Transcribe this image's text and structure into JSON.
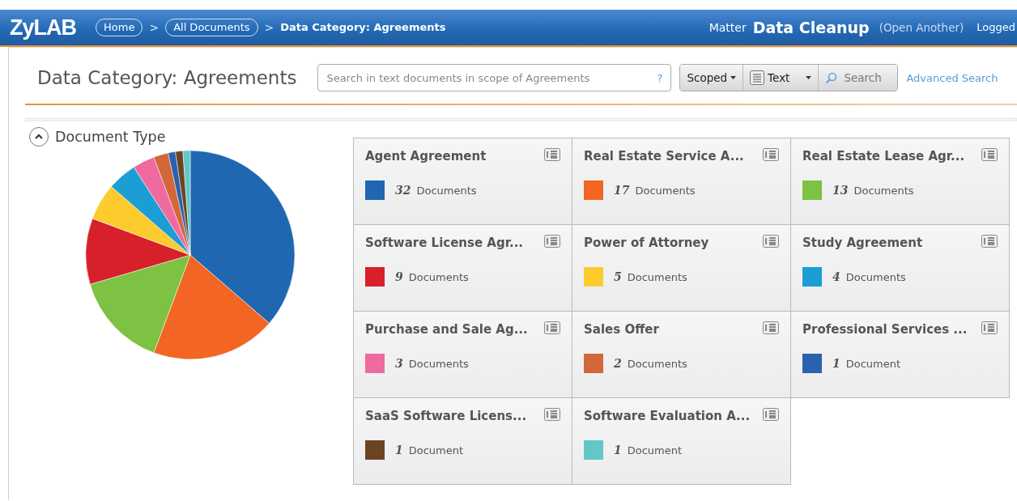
{
  "header": {
    "logo": "ZyLAB",
    "separator": ">",
    "breadcrumbs": [
      {
        "label": "Home",
        "kind": "link"
      },
      {
        "label": "All Documents",
        "kind": "link"
      },
      {
        "label": "Data Category: Agreements",
        "kind": "current"
      }
    ],
    "matter_label": "Matter",
    "matter_name": "Data Cleanup",
    "open_another": "(Open Another)",
    "user": "Logged"
  },
  "page_title": "Data Category: Agreements",
  "search": {
    "placeholder": "Search in text documents in scope of Agreements",
    "help": "?",
    "scope": "Scoped",
    "type": "Text",
    "button": "Search",
    "advanced": "Advanced Search"
  },
  "section": {
    "title": "Document Type",
    "expanded": true
  },
  "tiles": [
    {
      "title": "Agent Agreement",
      "count": "32",
      "unit": "Documents",
      "color": "#1f67b1"
    },
    {
      "title": "Real Estate Service A...",
      "count": "17",
      "unit": "Documents",
      "color": "#f26522"
    },
    {
      "title": "Real Estate Lease Agr...",
      "count": "13",
      "unit": "Documents",
      "color": "#7dc242"
    },
    {
      "title": "Software License Agr...",
      "count": "9",
      "unit": "Documents",
      "color": "#d7202a"
    },
    {
      "title": "Power of Attorney",
      "count": "5",
      "unit": "Documents",
      "color": "#fdcb2e"
    },
    {
      "title": "Study Agreement",
      "count": "4",
      "unit": "Documents",
      "color": "#1a9ed4"
    },
    {
      "title": "Purchase and Sale Ag...",
      "count": "3",
      "unit": "Documents",
      "color": "#ee6a9f"
    },
    {
      "title": "Sales Offer",
      "count": "2",
      "unit": "Documents",
      "color": "#d2673a"
    },
    {
      "title": "Professional Services ...",
      "count": "1",
      "unit": "Document",
      "color": "#2a62ad"
    },
    {
      "title": "SaaS Software Licens...",
      "count": "1",
      "unit": "Document",
      "color": "#6b4522"
    },
    {
      "title": "Software Evaluation A...",
      "count": "1",
      "unit": "Document",
      "color": "#63c7c7"
    }
  ]
}
